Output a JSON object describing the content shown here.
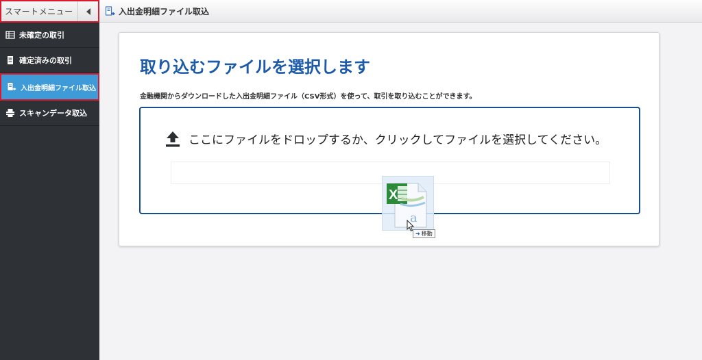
{
  "sidebar": {
    "header_title": "スマートメニュー",
    "items": [
      {
        "label": "未確定の取引",
        "icon": "list-icon"
      },
      {
        "label": "確定済みの取引",
        "icon": "document-icon"
      },
      {
        "label": "入出金明細ファイル取込",
        "icon": "file-import-icon",
        "active": true
      },
      {
        "label": "スキャンデータ取込",
        "icon": "scanner-icon"
      }
    ]
  },
  "topbar": {
    "title": "入出金明細ファイル取込",
    "icon": "file-import-icon"
  },
  "main": {
    "heading": "取り込むファイルを選択します",
    "description": "金融機関からダウンロードした入出金明細ファイル（CSV形式）を使って、取引を取り込むことができます。",
    "dropzone_text": "ここにファイルをドロップするか、クリックしてファイルを選択してください。"
  },
  "drag": {
    "badge_label": "移動",
    "file_icon": "excel-csv-file-icon"
  },
  "colors": {
    "sidebar_bg": "#2e3237",
    "active_item": "#3f9ad8",
    "heading": "#1d5aa7",
    "dropzone_border": "#174f8c",
    "highlight_border": "#d8192f"
  }
}
